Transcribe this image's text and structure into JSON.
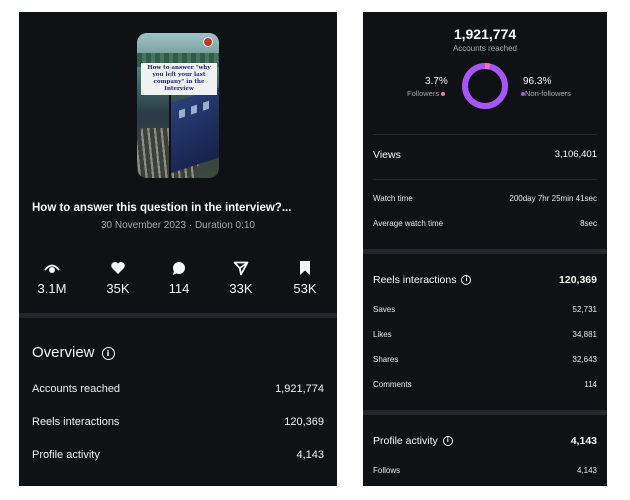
{
  "post": {
    "thumbnail_caption": "How to answer \"why you left your last company\" in the Interview",
    "title": "How to answer this question in the interview?...",
    "date": "30 November 2023",
    "separator": " · ",
    "duration": "Duration 0:10"
  },
  "stats": [
    {
      "icon": "eye-icon",
      "value": "3.1M"
    },
    {
      "icon": "heart-icon",
      "value": "35K"
    },
    {
      "icon": "comment-icon",
      "value": "114"
    },
    {
      "icon": "send-icon",
      "value": "33K"
    },
    {
      "icon": "bookmark-icon",
      "value": "53K"
    }
  ],
  "overview": {
    "title": "Overview",
    "rows": [
      {
        "label": "Accounts reached",
        "value": "1,921,774"
      },
      {
        "label": "Reels interactions",
        "value": "120,369"
      },
      {
        "label": "Profile activity",
        "value": "4,143"
      }
    ]
  },
  "reach": {
    "total": "1,921,774",
    "label": "Accounts reached",
    "followers_pct": "3.7%",
    "followers_label": "Followers",
    "nonfollowers_pct": "96.3%",
    "nonfollowers_label": "Non-followers",
    "followers_fraction": 0.037,
    "followers_color": "#f472b6",
    "nonfollowers_color": "#a855f7"
  },
  "views": {
    "label": "Views",
    "value": "3,106,401"
  },
  "watch": {
    "watch_time_label": "Watch time",
    "watch_time_value": "200day 7hr 25min 41sec",
    "avg_label": "Average watch time",
    "avg_value": "8sec"
  },
  "interactions": {
    "title": "Reels interactions",
    "total": "120,369",
    "rows": [
      {
        "label": "Saves",
        "value": "52,731"
      },
      {
        "label": "Likes",
        "value": "34,881"
      },
      {
        "label": "Shares",
        "value": "32,643"
      },
      {
        "label": "Comments",
        "value": "114"
      }
    ]
  },
  "profile": {
    "title": "Profile activity",
    "total": "4,143",
    "rows": [
      {
        "label": "Follows",
        "value": "4,143"
      }
    ]
  },
  "colors": {
    "background": "#0f1114",
    "divider": "#24272b",
    "accent": "#a855f7"
  }
}
